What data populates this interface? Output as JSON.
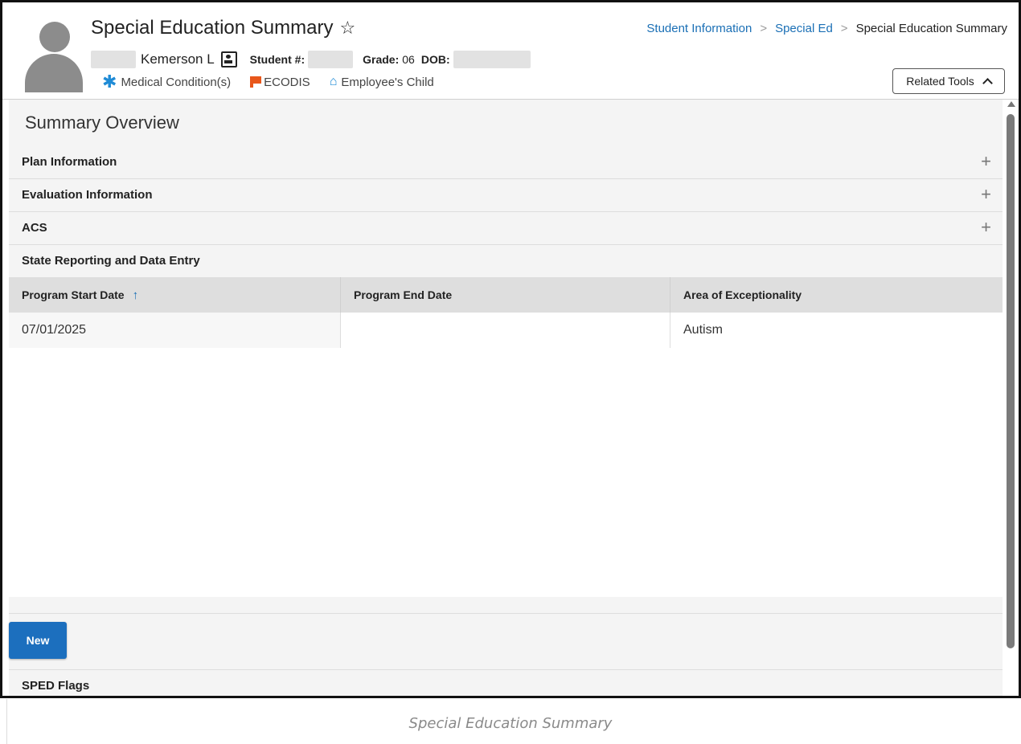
{
  "header": {
    "page_title": "Special Education Summary",
    "student_name": "Kemerson L",
    "student_number_label": "Student #:",
    "grade_label": "Grade:",
    "grade_value": "06",
    "dob_label": "DOB:",
    "flags": [
      {
        "label": "Medical Condition(s)",
        "icon": "asterisk-icon"
      },
      {
        "label": "ECODIS",
        "icon": "flag-icon"
      },
      {
        "label": "Employee's Child",
        "icon": "house-icon"
      }
    ],
    "breadcrumb": [
      "Student Information",
      "Special Ed",
      "Special Education Summary"
    ],
    "related_tools_label": "Related Tools"
  },
  "main": {
    "section_title": "Summary Overview",
    "accordions": [
      {
        "label": "Plan Information"
      },
      {
        "label": "Evaluation Information"
      },
      {
        "label": "ACS"
      }
    ],
    "state_reporting": {
      "title": "State Reporting and Data Entry",
      "columns": [
        "Program Start Date",
        "Program End Date",
        "Area of Exceptionality"
      ],
      "rows": [
        {
          "start": "07/01/2025",
          "end": "",
          "area": "Autism"
        }
      ],
      "new_button_label": "New"
    },
    "sped_flags_title": "SPED Flags"
  },
  "caption": "Special Education Summary",
  "colors": {
    "primary": "#1c6fbe",
    "link": "#1a6fb5",
    "flag_orange": "#e8571b",
    "icon_blue": "#1f8bd6"
  }
}
